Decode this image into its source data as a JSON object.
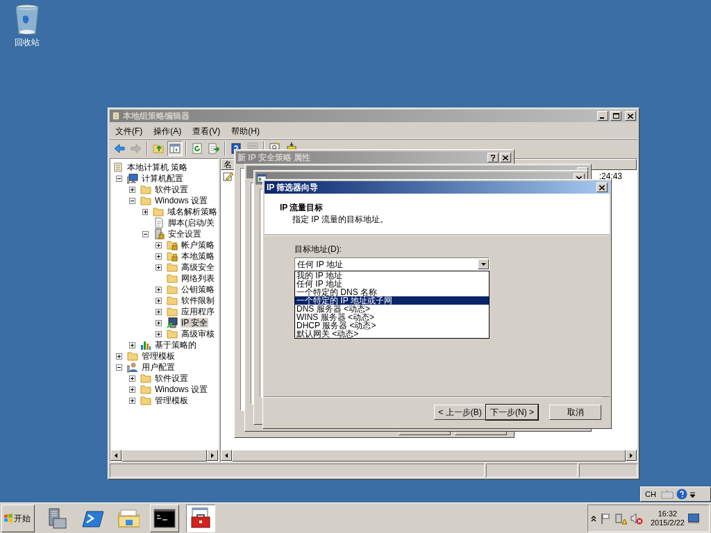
{
  "desktop_icons": [
    {
      "label": "回收站"
    }
  ],
  "main_window": {
    "title": "本地组策略编辑器",
    "menu": [
      "文件(F)",
      "操作(A)",
      "查看(V)",
      "帮助(H)"
    ],
    "toolbar": [
      {
        "kind": "back",
        "disabled": false,
        "pressed": false
      },
      {
        "kind": "forward",
        "disabled": true,
        "pressed": false
      },
      {
        "kind": "up",
        "disabled": false,
        "pressed": false
      },
      {
        "kind": "tree",
        "disabled": false,
        "pressed": true
      },
      {
        "kind": "refresh",
        "disabled": false,
        "pressed": false
      },
      {
        "kind": "export",
        "disabled": false,
        "pressed": false
      },
      {
        "kind": "help",
        "disabled": false,
        "pressed": false
      },
      {
        "kind": "bar",
        "disabled": true,
        "pressed": false
      },
      {
        "kind": "policy",
        "disabled": false,
        "pressed": false
      },
      {
        "kind": "assign",
        "disabled": false,
        "pressed": false
      }
    ],
    "tree": [
      {
        "label": "本地计算机 策略",
        "kind": "policy",
        "selected": false,
        "children": [
          {
            "label": "计算机配置",
            "kind": "computer",
            "expanded": true,
            "selected": false,
            "children": [
              {
                "label": "软件设置",
                "kind": "folder",
                "expanded": false,
                "selected": false
              },
              {
                "label": "Windows 设置",
                "kind": "folder",
                "expanded": true,
                "selected": false,
                "children": [
                  {
                    "label": "域名解析策略",
                    "kind": "folder",
                    "expanded": false,
                    "selected": false
                  },
                  {
                    "label": "脚本(启动/关",
                    "kind": "script",
                    "selected": false
                  },
                  {
                    "label": "安全设置",
                    "kind": "security",
                    "expanded": true,
                    "selected": false,
                    "children": [
                      {
                        "label": "帐户策略",
                        "kind": "locked-folder",
                        "expanded": false,
                        "selected": false
                      },
                      {
                        "label": "本地策略",
                        "kind": "locked-folder",
                        "expanded": false,
                        "selected": false
                      },
                      {
                        "label": "高级安全",
                        "kind": "folder",
                        "expanded": false,
                        "selected": false
                      },
                      {
                        "label": "网络列表",
                        "kind": "folder",
                        "selected": false
                      },
                      {
                        "label": "公钥策略",
                        "kind": "folder",
                        "expanded": false,
                        "selected": false
                      },
                      {
                        "label": "软件限制",
                        "kind": "folder",
                        "expanded": false,
                        "selected": false
                      },
                      {
                        "label": "应用程序",
                        "kind": "folder",
                        "expanded": false,
                        "selected": false
                      },
                      {
                        "label": "IP 安全",
                        "kind": "ip-security",
                        "expanded": false,
                        "selected": true
                      },
                      {
                        "label": "高级审核",
                        "kind": "folder",
                        "expanded": false,
                        "selected": false
                      }
                    ]
                  }
                ]
              },
              {
                "label": "基于策略的",
                "kind": "chart",
                "expanded": false,
                "selected": false
              }
            ]
          },
          {
            "label": "管理模板",
            "kind": "folder",
            "expanded": false,
            "selected": false
          },
          {
            "label": "用户配置",
            "kind": "user",
            "expanded": true,
            "selected": false,
            "children": [
              {
                "label": "软件设置",
                "kind": "folder",
                "expanded": false,
                "selected": false
              },
              {
                "label": "Windows 设置",
                "kind": "folder",
                "expanded": false,
                "selected": false
              },
              {
                "label": "管理模板",
                "kind": "folder",
                "expanded": false,
                "selected": false
              }
            ]
          }
        ]
      }
    ],
    "list_columns": [
      "名"
    ],
    "list_rows": [
      {
        "column_2": ":24:43"
      }
    ]
  },
  "dialogs_behind": [
    {
      "title": "新 IP 安全策略 属性",
      "help": true
    },
    {
      "help": false
    },
    {
      "help": false
    }
  ],
  "wizard": {
    "title": "IP 筛选器向导",
    "heading": "IP 流量目标",
    "subheading": "指定 IP 流量的目标地址。",
    "field_label": "目标地址(D):",
    "combo_value": "任何 IP 地址",
    "options": [
      {
        "label": "我的 IP 地址",
        "selected": false
      },
      {
        "label": "任何 IP 地址",
        "selected": false
      },
      {
        "label": "一个特定的 DNS 名称",
        "selected": false
      },
      {
        "label": "一个特定的 IP 地址或子网",
        "selected": true
      },
      {
        "label": "DNS 服务器 <动态>",
        "selected": false
      },
      {
        "label": "WINS 服务器 <动态>",
        "selected": false
      },
      {
        "label": "DHCP 服务器 <动态>",
        "selected": false
      },
      {
        "label": "默认网关 <动态>",
        "selected": false
      }
    ],
    "buttons": [
      {
        "label": "< 上一步(B)",
        "default": false
      },
      {
        "label": "下一步(N) >",
        "default": true
      },
      {
        "label": "取消",
        "default": false
      }
    ]
  },
  "language_bar": {
    "language": "CH"
  },
  "taskbar": {
    "start": "开始",
    "apps": [
      {
        "kind": "server",
        "running": false,
        "selected": false
      },
      {
        "kind": "powershell",
        "running": false,
        "selected": false
      },
      {
        "kind": "explorer",
        "running": false,
        "selected": false
      },
      {
        "kind": "console",
        "running": true,
        "selected": false
      },
      {
        "kind": "toolbox",
        "running": true,
        "selected": true
      }
    ],
    "clock": {
      "time": "16:32",
      "date": "2015/2/22"
    }
  }
}
